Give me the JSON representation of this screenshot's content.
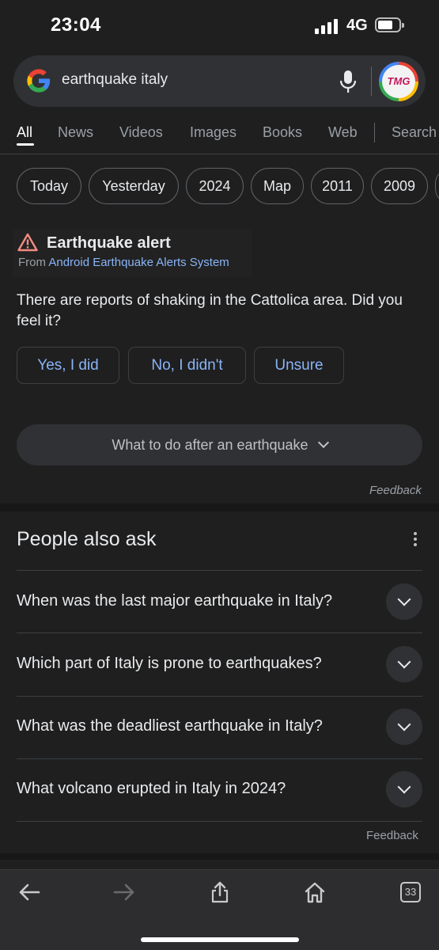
{
  "status": {
    "time": "23:04",
    "network": "4G"
  },
  "search": {
    "query": "earthquake italy",
    "avatar_text": "TMG"
  },
  "tabs": [
    {
      "label": "All",
      "active": true
    },
    {
      "label": "News"
    },
    {
      "label": "Videos"
    },
    {
      "label": "Images"
    },
    {
      "label": "Books"
    },
    {
      "label": "Web"
    },
    {
      "label": "Search"
    }
  ],
  "chips": [
    "Today",
    "Yesterday",
    "2024",
    "Map",
    "2011",
    "2009"
  ],
  "alert": {
    "title": "Earthquake alert",
    "from_prefix": "From ",
    "from_source": "Android Earthquake Alerts System",
    "body": "There are reports of shaking in the Cattolica area. Did you feel it?",
    "responses": [
      "Yes, I did",
      "No, I didn't",
      "Unsure"
    ],
    "expand_label": "What to do after an earthquake",
    "feedback": "Feedback"
  },
  "people_also_ask": {
    "title": "People also ask",
    "questions": [
      "When was the last major earthquake in Italy?",
      "Which part of Italy is prone to earthquakes?",
      "What was the deadliest earthquake in Italy?",
      "What volcano erupted in Italy in 2024?"
    ],
    "feedback": "Feedback"
  },
  "toolbar": {
    "tab_count": "33"
  },
  "colors": {
    "background": "#1f1f1f",
    "link": "#8ab4f8",
    "warning": "#f28b82"
  },
  "icons": [
    "google-logo-icon",
    "mic-icon",
    "warning-icon",
    "more-vert-icon",
    "chevron-down-icon",
    "back-icon",
    "forward-icon",
    "share-icon",
    "home-icon",
    "tabs-icon"
  ]
}
